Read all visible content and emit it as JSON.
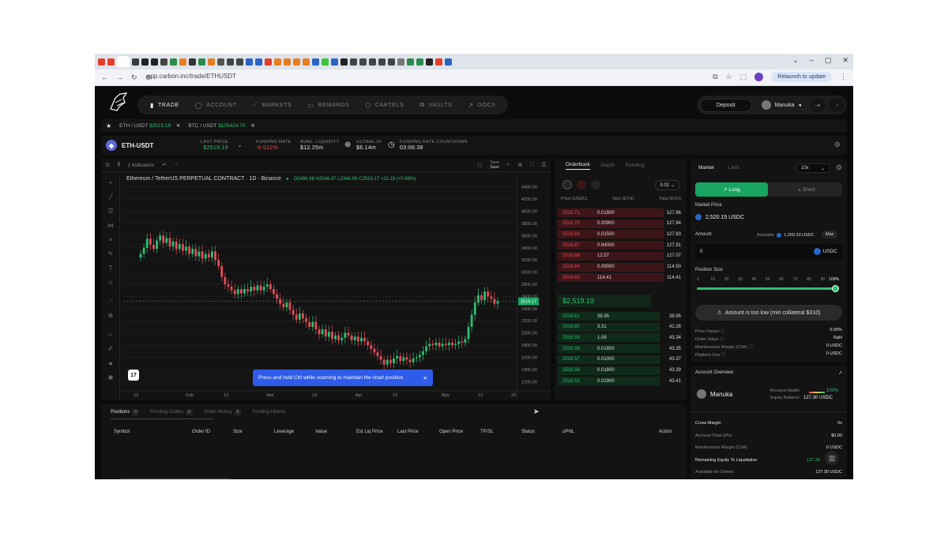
{
  "browser": {
    "url": "app.carbon.inc/trade/ETHUSDT",
    "relaunch_label": "Relaunch to update",
    "profile_initial": "S",
    "tab_colors": [
      "#e33e2b",
      "#e33e2b",
      "#ffffff",
      "#3b3b3b",
      "#222222",
      "#222222",
      "#444444",
      "#2a8a4a",
      "#e67e22",
      "#333333",
      "#2a8a4a",
      "#e67e22",
      "#555555",
      "#444444",
      "#444444",
      "#2a64c4",
      "#2a64c4",
      "#e33e2b",
      "#e67e22",
      "#e67e22",
      "#e67e22",
      "#e67e22",
      "#2a64c4",
      "#3ec43e",
      "#2a64c4",
      "#222222",
      "#444444",
      "#444444",
      "#444444",
      "#444444",
      "#444444",
      "#777777",
      "#2a8a4a",
      "#2a8a4a",
      "#222222",
      "#e33e2b",
      "#2a64c4"
    ]
  },
  "nav": {
    "items": [
      {
        "label": "TRADE",
        "icon": "bar-chart-icon",
        "active": true
      },
      {
        "label": "ACCOUNT",
        "icon": "user-icon",
        "active": false
      },
      {
        "label": "MARKETS",
        "icon": "line-chart-icon",
        "active": false
      },
      {
        "label": "REWARDS",
        "icon": "gift-icon",
        "active": false
      },
      {
        "label": "CARTELS",
        "icon": "shield-icon",
        "active": false
      },
      {
        "label": "VAULTS",
        "icon": "vault-icon",
        "active": false
      },
      {
        "label": "DOCS",
        "icon": "arrow-up-right-icon",
        "active": false
      }
    ],
    "deposit_label": "Deposit",
    "username": "Manuka"
  },
  "favorites": [
    {
      "name": "ETH / USDT",
      "price": "$2519.19"
    },
    {
      "name": "BTC / USDT",
      "price": "$105424.70"
    }
  ],
  "market": {
    "name": "ETH-USDT",
    "stats": [
      {
        "label": "LAST PRICE",
        "value": "$2519.19",
        "tone": "green"
      },
      {
        "label": "FUNDING RATE",
        "value": "-0.012%",
        "tone": "red"
      },
      {
        "label": "AVAIL. LIQUIDITY",
        "value": "$12.25m",
        "tone": ""
      },
      {
        "label": "GLOBAL OI",
        "value": "$6.14m",
        "tone": ""
      },
      {
        "label": "FUNDING RATE COUNTDOWN",
        "value": "03:06:38",
        "tone": ""
      }
    ]
  },
  "chart_toolbar": {
    "interval": "D",
    "indicators_label": "Indicators",
    "save_label": "Save",
    "save_sub": "Save"
  },
  "chart_data": {
    "type": "candlestick",
    "title": "Ethereum / TetherUS PERPETUAL CONTRACT · 1D · Binance",
    "ohlc": {
      "o": "2496.98",
      "h": "2546.97",
      "l": "2346.99",
      "c": "2519.17",
      "chg": "+22.19 (+0.89%)"
    },
    "ylim": [
      1100,
      4500
    ],
    "y_ticks": [
      4400,
      4200,
      4000,
      3800,
      3600,
      3400,
      3200,
      3000,
      2800,
      2600,
      2400,
      2200,
      2000,
      1800,
      1600,
      1400,
      1200
    ],
    "y_tick_labels": [
      "4400.00",
      "4200.00",
      "4000.00",
      "3800.00",
      "3600.00",
      "3400.00",
      "3200.00",
      "3000.00",
      "2800.00",
      "2600.00",
      "2400.00",
      "2200.00",
      "2000.00",
      "1800.00",
      "1600.00",
      "1400.00",
      "1200.00"
    ],
    "x_ticks": [
      "13",
      "Feb",
      "13",
      "Mar",
      "13",
      "Apr",
      "13",
      "May",
      "13",
      "25"
    ],
    "last_price_label": "2519.17",
    "candles_close": [
      3300,
      3400,
      3550,
      3450,
      3380,
      3520,
      3600,
      3480,
      3560,
      3420,
      3500,
      3380,
      3460,
      3350,
      3420,
      3300,
      3380,
      3260,
      3340,
      3220,
      3300,
      3240,
      3340,
      3200,
      3100,
      2920,
      2800,
      2760,
      2700,
      2640,
      2720,
      2650,
      2720,
      2680,
      2760,
      2700,
      2780,
      2700,
      2760,
      2800,
      2720,
      2640,
      2560,
      2480,
      2420,
      2500,
      2380,
      2300,
      2220,
      2320,
      2240,
      2180,
      2100,
      2180,
      2060,
      1980,
      2060,
      1940,
      2020,
      1900,
      1960,
      1880,
      1920,
      2000,
      1960,
      1880,
      1940,
      1860,
      1920,
      1860,
      1800,
      1740,
      1680,
      1620,
      1560,
      1480,
      1560,
      1500,
      1580,
      1620,
      1540,
      1600,
      1560,
      1520,
      1580,
      1600,
      1640,
      1700,
      1780,
      1820,
      1800,
      1840,
      1780,
      1820,
      1800,
      1840,
      1800,
      1820,
      1860,
      1840,
      1900,
      2100,
      2300,
      2500,
      2620,
      2540,
      2680,
      2600,
      2560,
      2480,
      2520
    ]
  },
  "toast": {
    "text": "Press and hold Ctrl while zooming to maintain the chart position"
  },
  "orderbook": {
    "tabs": [
      "Orderbook",
      "Depth",
      "Funding"
    ],
    "tick": "0.01",
    "headers": [
      "Price (USDC)",
      "Size (ETH)",
      "Total (ETH)"
    ],
    "asks": [
      {
        "price": "2518.71",
        "size": "0.01800",
        "total": "127.96"
      },
      {
        "price": "2518.70",
        "size": "0.00900",
        "total": "127.94"
      },
      {
        "price": "2518.69",
        "size": "0.01500",
        "total": "127.93"
      },
      {
        "price": "2518.67",
        "size": "0.84000",
        "total": "127.91"
      },
      {
        "price": "2518.66",
        "size": "12.57",
        "total": "127.07"
      },
      {
        "price": "2518.64",
        "size": "0.09000",
        "total": "114.50"
      },
      {
        "price": "2518.63",
        "size": "114.41",
        "total": "114.41"
      }
    ],
    "mid": "$2,519.19",
    "bids": [
      {
        "price": "2518.61",
        "size": "38.95",
        "total": "38.95"
      },
      {
        "price": "2518.60",
        "size": "3.31",
        "total": "42.26"
      },
      {
        "price": "2518.59",
        "size": "1.08",
        "total": "43.34"
      },
      {
        "price": "2518.58",
        "size": "0.01800",
        "total": "43.35"
      },
      {
        "price": "2518.57",
        "size": "0.01000",
        "total": "43.37"
      },
      {
        "price": "2518.56",
        "size": "0.01800",
        "total": "43.39"
      },
      {
        "price": "2518.53",
        "size": "0.01900",
        "total": "43.41"
      }
    ]
  },
  "trade": {
    "tabs": [
      "Market",
      "Limit"
    ],
    "leverage": "10x",
    "long_label": "Long",
    "short_label": "Short",
    "market_price_label": "Market Price",
    "market_price": "2,520.15 USDC",
    "amount_label": "Amount",
    "available_label": "Available",
    "available_value": "1,260.33 USDC",
    "max_label": "Max",
    "amount_value": "0",
    "amount_unit": "USDC",
    "position_size_label": "Position Size",
    "slider_marks": [
      "1",
      "10",
      "20",
      "30",
      "40",
      "50",
      "60",
      "70",
      "80",
      "90",
      "100%"
    ],
    "slider_percent": 100,
    "warning": "Amount is too low (min collateral $310)",
    "details": [
      {
        "label": "Price Impact",
        "value": "0.00%"
      },
      {
        "label": "Order Value",
        "value": "NaN"
      },
      {
        "label": "Maintenance Margin (CVA)",
        "value": "0 USDC"
      },
      {
        "label": "Platform Fee",
        "value": "0 USDC"
      }
    ]
  },
  "account": {
    "title": "Account Overview",
    "username": "Manuka",
    "health_label": "Account Health",
    "health_value": "100%",
    "equity_label": "Equity Balance",
    "equity_value": "127.30 USDC",
    "rows": [
      {
        "label": "Cross Margin",
        "value": "0x",
        "bold": true
      },
      {
        "label": "Account Total uPnL",
        "value": "$0.00",
        "bold": false
      },
      {
        "label": "Maintenance Margin (CVA)",
        "value": "0 USDC",
        "bold": false
      },
      {
        "label": "Remaining Equity To Liquidation",
        "value": "127.30",
        "bold": true
      },
      {
        "label": "Available for Orders",
        "value": "127.30 USDC",
        "bold": false
      }
    ]
  },
  "positions": {
    "tabs": [
      {
        "label": "Positions",
        "count": "0",
        "active": true
      },
      {
        "label": "Pending Orders",
        "count": "0",
        "active": false
      },
      {
        "label": "Order History",
        "count": "6",
        "active": false
      },
      {
        "label": "Funding History",
        "count": "",
        "active": false
      }
    ],
    "columns": [
      "Symbol",
      "Order ID",
      "Size",
      "Leverage",
      "Value",
      "Est Liq Price",
      "Last Price",
      "Open Price",
      "TP/SL",
      "Status",
      "uPNL",
      "Action"
    ]
  },
  "colors": {
    "up": "#2fbf71",
    "down": "#e24e59",
    "accent": "#17a561",
    "toast": "#2f5bea"
  }
}
